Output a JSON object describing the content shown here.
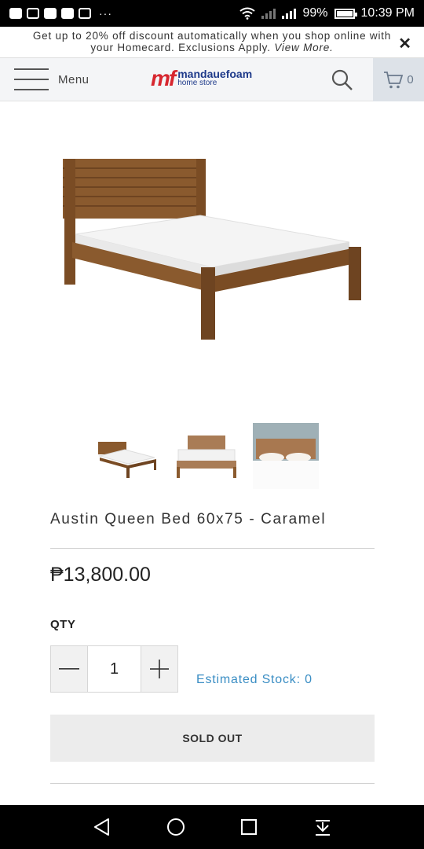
{
  "status_bar": {
    "battery": "99%",
    "time": "10:39 PM",
    "overflow": "···"
  },
  "promo": {
    "text": "Get up to 20% off discount automatically when you shop online with your Homecard. Exclusions Apply.",
    "link": "View More.",
    "close": "✕"
  },
  "header": {
    "menu_label": "Menu",
    "logo_mark": "mf",
    "logo_name": "mandauefoam",
    "logo_sub": "home store",
    "cart_count": "0"
  },
  "product": {
    "title": "Austin Queen Bed 60x75 - Caramel",
    "price": "₱13,800.00",
    "qty_label": "QTY",
    "qty_value": "1",
    "stock": "Estimated Stock: 0",
    "soldout_label": "SOLD OUT"
  },
  "colors": {
    "accent_blue": "#3b8ec4",
    "brand_red": "#d7262f",
    "brand_blue": "#1e3a8a",
    "wood": "#8a5a2e"
  }
}
